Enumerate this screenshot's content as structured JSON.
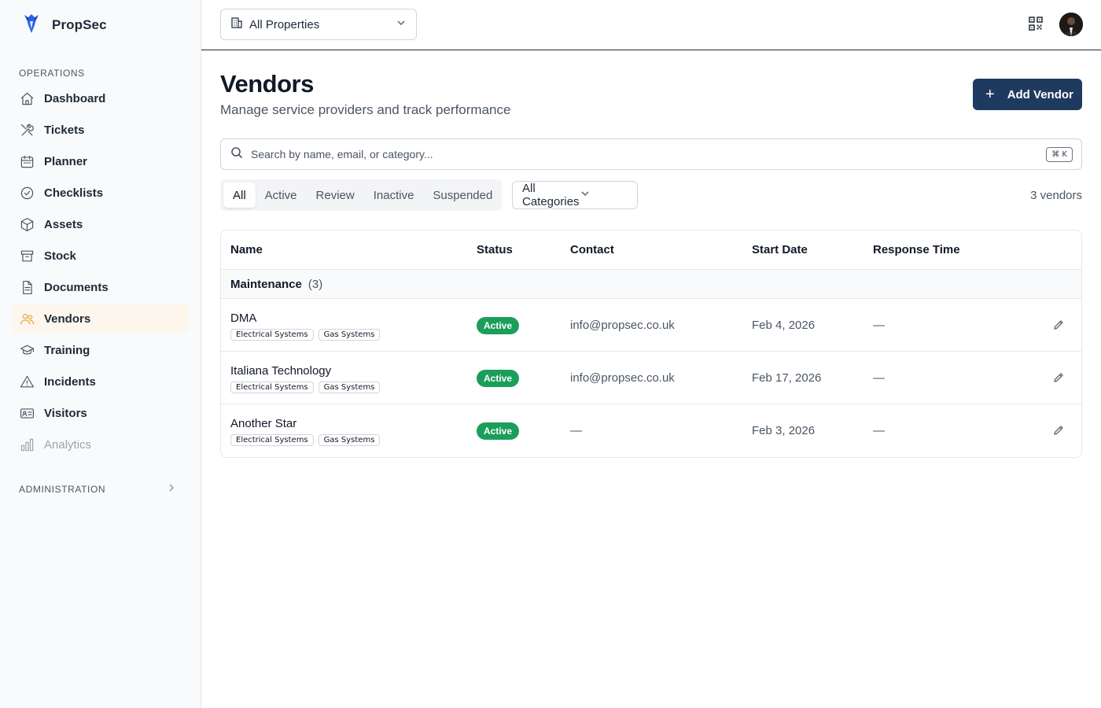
{
  "app": {
    "name": "PropSec",
    "logo_icon": "propsec-logo-icon",
    "accent": "#e8a33d",
    "primary": "#1e3a5f"
  },
  "sidebar": {
    "operations_label": "OPERATIONS",
    "items": [
      {
        "label": "Dashboard",
        "icon": "home-icon"
      },
      {
        "label": "Tickets",
        "icon": "tools-icon"
      },
      {
        "label": "Planner",
        "icon": "calendar-icon"
      },
      {
        "label": "Checklists",
        "icon": "check-circle-icon"
      },
      {
        "label": "Assets",
        "icon": "cube-icon"
      },
      {
        "label": "Stock",
        "icon": "archive-icon"
      },
      {
        "label": "Documents",
        "icon": "document-icon"
      },
      {
        "label": "Vendors",
        "icon": "users-icon",
        "active": true
      },
      {
        "label": "Training",
        "icon": "graduation-cap-icon"
      },
      {
        "label": "Incidents",
        "icon": "warning-triangle-icon"
      },
      {
        "label": "Visitors",
        "icon": "id-card-icon"
      },
      {
        "label": "Analytics",
        "icon": "bar-chart-icon",
        "muted": true
      }
    ],
    "administration_label": "ADMINISTRATION"
  },
  "topbar": {
    "property_select": "All Properties",
    "qr_icon": "qr-code-icon",
    "avatar_icon": "user-avatar"
  },
  "page": {
    "title": "Vendors",
    "subtitle": "Manage service providers and track performance",
    "add_button": "Add Vendor",
    "search_placeholder": "Search by name, email, or category...",
    "search_shortcut": "⌘ K",
    "tabs": [
      "All",
      "Active",
      "Review",
      "Inactive",
      "Suspended"
    ],
    "active_tab": "All",
    "category_select": "All Categories",
    "count": "3 vendors"
  },
  "table": {
    "columns": [
      "Name",
      "Status",
      "Contact",
      "Start Date",
      "Response Time"
    ],
    "group": {
      "name": "Maintenance",
      "count": "(3)"
    },
    "rows": [
      {
        "name": "DMA",
        "tags": [
          "Electrical Systems",
          "Gas Systems"
        ],
        "status": "Active",
        "contact": "info@propsec.co.uk",
        "start_date": "Feb 4, 2026",
        "response_time": "—"
      },
      {
        "name": "Italiana Technology",
        "tags": [
          "Electrical Systems",
          "Gas Systems"
        ],
        "status": "Active",
        "contact": "info@propsec.co.uk",
        "start_date": "Feb 17, 2026",
        "response_time": "—"
      },
      {
        "name": "Another Star",
        "tags": [
          "Electrical Systems",
          "Gas Systems"
        ],
        "status": "Active",
        "contact": "—",
        "start_date": "Feb 3, 2026",
        "response_time": "—"
      }
    ],
    "status_color": "#1b9e5a"
  }
}
